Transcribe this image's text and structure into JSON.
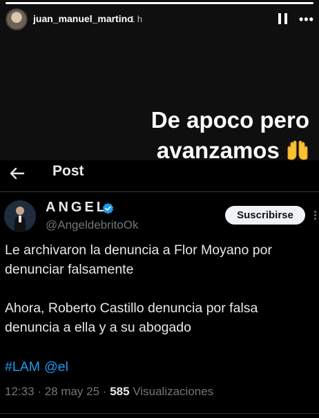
{
  "story": {
    "progress": 1.0,
    "username": "juan_manuel_martino",
    "time_ago": "1 h",
    "caption_line1": "De apoco pero",
    "caption_line2": "avanzamos",
    "caption_emoji": "raised-hands-icon"
  },
  "tweet": {
    "header_title": "Post",
    "author_name": "ANGEL",
    "author_handle": "@AngeldebritoOk",
    "subscribe_label": "Suscribirse",
    "text_line1": "Le archivaron la denuncia a Flor Moyano por denunciar falsamente",
    "text_line2": "Ahora, Roberto Castillo denuncia por falsa denuncia a ella y a su abogado",
    "hashtag": "#LAM",
    "mention": "@el",
    "time": "12:33",
    "separator": "·",
    "date": "28 may 25",
    "views_count": "585",
    "views_label": "Visualizaciones"
  },
  "colors": {
    "link": "#1d9bf0",
    "verified": "#1d9bf0",
    "muted": "#71767b"
  }
}
